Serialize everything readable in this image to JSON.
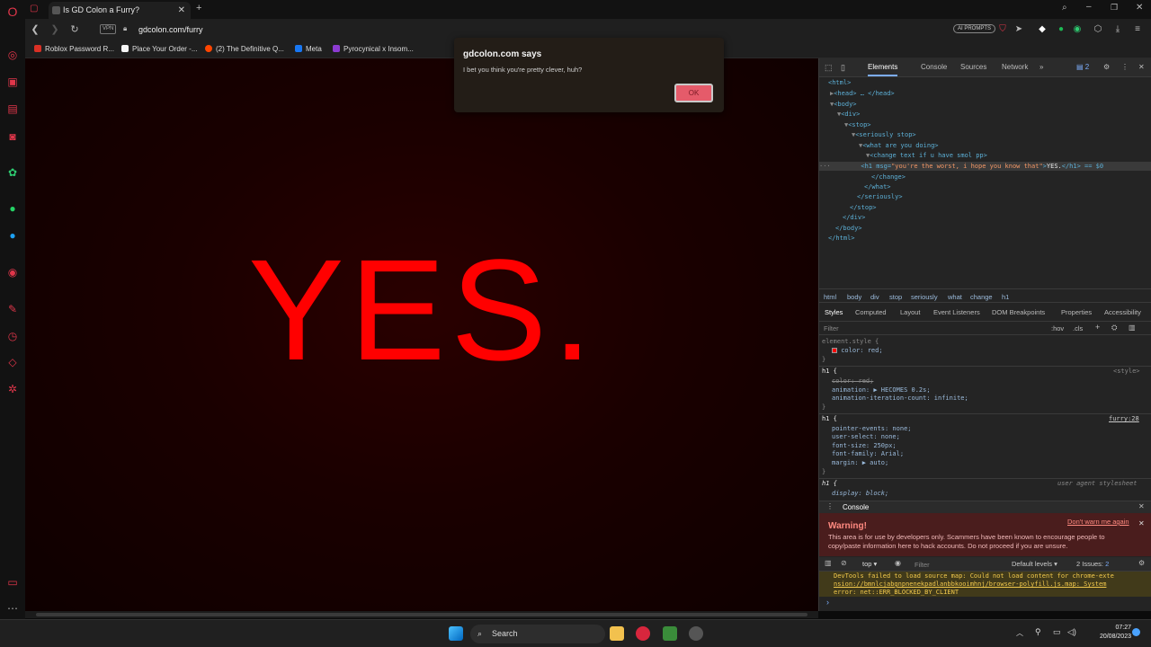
{
  "browser": {
    "tab_title": "Is GD Colon a Furry?",
    "tab_close": "✕",
    "new_tab": "+",
    "vpn_label": "VPN",
    "url": "gdcolon.com/furry",
    "ai_prompts": "AI PROMPTS",
    "bookmarks": [
      {
        "label": "Roblox Password R...",
        "color": "#d93025"
      },
      {
        "label": "Place Your Order -...",
        "color": "#f5f5f5"
      },
      {
        "label": "(2) The Definitive Q...",
        "color": "#ff4500"
      },
      {
        "label": "Meta",
        "color": "#1877f2"
      },
      {
        "label": "Pyrocynical x Insom...",
        "color": "#8c3bd1"
      }
    ]
  },
  "page": {
    "headline": "YES.",
    "headline_color": "#ff0000"
  },
  "alert": {
    "title": "gdcolon.com says",
    "message": "I bet you think you're pretty clever, huh?",
    "ok_label": "OK"
  },
  "devtools": {
    "tabs": [
      "Elements",
      "Console",
      "Sources",
      "Network"
    ],
    "issue_count": "2",
    "dom_lines": [
      "<html>",
      "<head> … </head>",
      "<body>",
      "<div>",
      "<stop>",
      "<seriously stop>",
      "<what are you doing>",
      "<change text if u have smol pp>",
      "</change>",
      "</what>",
      "</seriously>",
      "</stop>",
      "</div>",
      "</body>",
      "</html>"
    ],
    "selected_h1": {
      "open": "<h1 msg=",
      "msg": "\"you're the worst, i hope you know that\"",
      "text": "YES.",
      "close": "</h1> == $0"
    },
    "breadcrumbs": [
      "html",
      "body",
      "div",
      "stop",
      "seriously",
      "what",
      "change",
      "h1"
    ],
    "sub_tabs": [
      "Styles",
      "Computed",
      "Layout",
      "Event Listeners",
      "DOM Breakpoints",
      "Properties",
      "Accessibility"
    ],
    "filter_placeholder": "Filter",
    "hov": ":hov",
    "cls": ".cls",
    "styles": {
      "element_style": "element.style {",
      "color_red": "color: red;",
      "h1_open": "h1 {",
      "style_src": "<style>",
      "strike_color": "color: red;",
      "animation": "animation: ▶ HECOMES 0.2s;",
      "anim_iter": "animation-iteration-count: infinite;",
      "close": "}",
      "furry_src": "furry:28",
      "pointer": "pointer-events: none;",
      "user_select": "user-select: none;",
      "font_size": "font-size: 250px;",
      "font_family": "font-family: Arial;",
      "margin": "margin: ▶ auto;",
      "ua": "user agent stylesheet",
      "display": "display: block;"
    },
    "console": {
      "title": "Console",
      "warning_title": "Warning!",
      "warning_text": "This area is for use by developers only. Scammers have been known to encourage people to copy/paste information here to hack accounts. Do not proceed if you are unsure.",
      "dont_warn": "Don't warn me again",
      "context": "top",
      "filter": "Filter",
      "levels": "Default levels",
      "issues": "2 Issues:",
      "issues_count": "2",
      "error_line1": "DevTools failed to load source map: Could not load content for chrome-exte",
      "error_line2": "nsion://bmnlcjabgnpnenekpadlanbbkooimhnj/browser-polyfill.js.map: System",
      "error_line3": "error: net::ERR_BLOCKED_BY_CLIENT",
      "prompt": "›"
    }
  },
  "taskbar": {
    "search_label": "Search",
    "time": "07:27",
    "date": "20/08/2023"
  }
}
